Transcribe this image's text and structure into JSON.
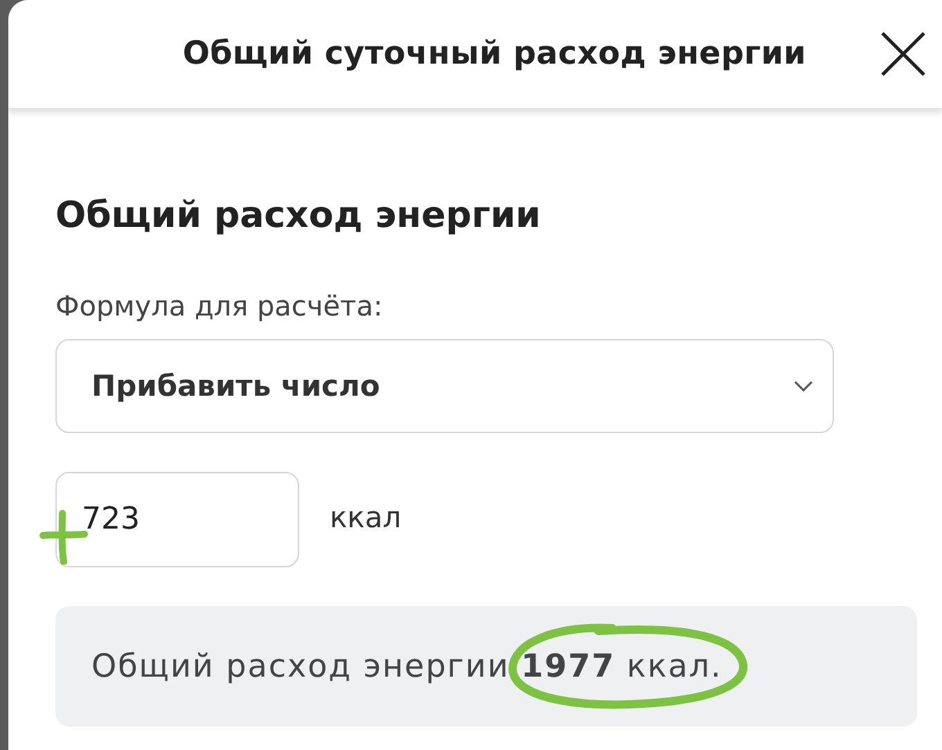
{
  "dialog": {
    "title": "Общий суточный расход энергии"
  },
  "section": {
    "heading": "Общий расход энергии",
    "formula_label": "Формула для расчёта:",
    "formula_value": "Прибавить число",
    "number_value": "723",
    "unit": "ккал",
    "result": "Общий расход энергии **1977** ккал."
  }
}
